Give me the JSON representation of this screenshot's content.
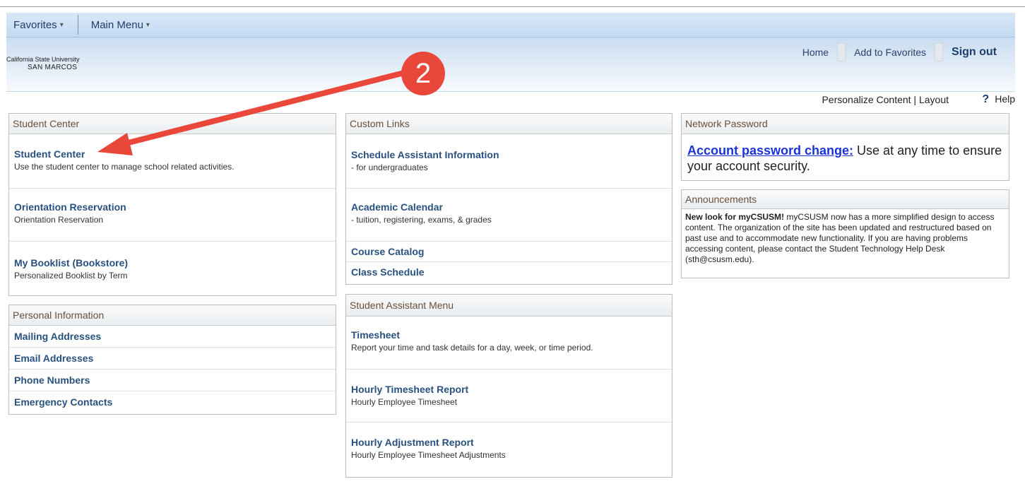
{
  "nav": {
    "favorites": "Favorites",
    "main_menu": "Main Menu"
  },
  "header": {
    "logo_line1": "California State University",
    "logo_line2": "SAN MARCOS",
    "home": "Home",
    "add_favorites": "Add to Favorites",
    "sign_out": "Sign out",
    "badge": "2"
  },
  "toolbar": {
    "personalize": "Personalize Content | Layout",
    "help_icon": "?",
    "help": "Help"
  },
  "student_center": {
    "title": "Student Center",
    "items": [
      {
        "title": "Student Center",
        "desc": "Use the student center to manage school related activities."
      },
      {
        "title": "Orientation Reservation",
        "desc": "Orientation Reservation"
      },
      {
        "title": "My Booklist (Bookstore)",
        "desc": "Personalized Booklist by Term"
      }
    ]
  },
  "personal_info": {
    "title": "Personal Information",
    "links": [
      "Mailing Addresses",
      "Email Addresses",
      "Phone Numbers",
      "Emergency Contacts"
    ]
  },
  "custom_links": {
    "title": "Custom Links",
    "items": [
      {
        "title": "Schedule Assistant Information",
        "desc": "- for undergraduates"
      },
      {
        "title": "Academic Calendar",
        "desc": "- tuition, registering, exams, & grades"
      }
    ],
    "links": [
      "Course Catalog",
      "Class Schedule"
    ]
  },
  "student_assistant": {
    "title": "Student Assistant Menu",
    "items": [
      {
        "title": "Timesheet",
        "desc": "Report your time and task details for a day, week, or time period."
      },
      {
        "title": "Hourly Timesheet Report",
        "desc": "Hourly Employee Timesheet"
      },
      {
        "title": "Hourly Adjustment Report",
        "desc": "Hourly Employee Timesheet Adjustments"
      }
    ]
  },
  "network_password": {
    "title": "Network Password",
    "link": "Account password change:",
    "text": " Use at any time to ensure your account security."
  },
  "announcements": {
    "title": "Announcements",
    "bold": "New look for myCSUSM!",
    "text": "  myCSUSM now has a more simplified design to access content.  The organization of the site has been updated and restructured based on past use and to accommodate new functionality.  If you are having problems accessing content, please contact the Student Technology Help Desk (sth@csusm.edu)."
  },
  "colors": {
    "badge": "#e8473a",
    "arrow": "#e8473a",
    "link": "#28517f"
  }
}
